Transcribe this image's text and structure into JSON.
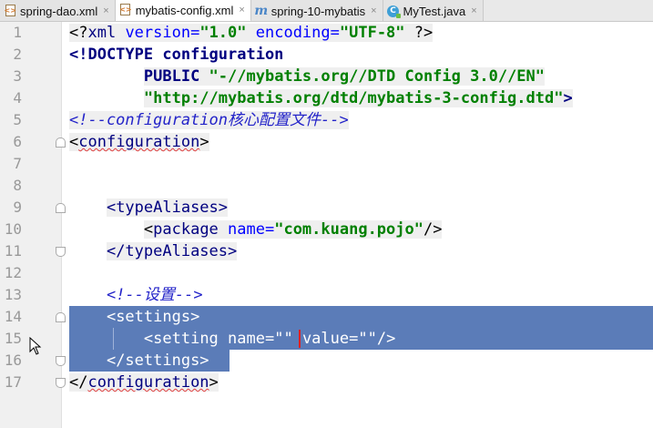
{
  "tabs": [
    {
      "label": "spring-dao.xml",
      "icon": "xml-file-icon",
      "close": "×",
      "active": false
    },
    {
      "label": "mybatis-config.xml",
      "icon": "xml-file-icon",
      "close": "×",
      "active": true
    },
    {
      "label": "spring-10-mybatis",
      "icon": "maven-module-icon",
      "close": "×",
      "active": false
    },
    {
      "label": "MyTest.java",
      "icon": "java-class-icon",
      "close": "×",
      "active": false
    }
  ],
  "line_numbers": [
    "1",
    "2",
    "3",
    "4",
    "5",
    "6",
    "7",
    "8",
    "9",
    "10",
    "11",
    "12",
    "13",
    "14",
    "15",
    "16",
    "17"
  ],
  "code": {
    "l1": {
      "open": "<?",
      "tag": "xml",
      "a1": " version=",
      "v1": "\"1.0\"",
      "a2": " encoding=",
      "v2": "\"UTF-8\"",
      "close": " ?>"
    },
    "l2": {
      "kw": "<!DOCTYPE",
      "name": " configuration"
    },
    "l3": {
      "indent": "        ",
      "kw": "PUBLIC",
      "str": " \"-//mybatis.org//DTD Config 3.0//EN\""
    },
    "l4": {
      "indent": "        ",
      "str": "\"http://mybatis.org/dtd/mybatis-3-config.dtd\"",
      "close": ">"
    },
    "l5": {
      "comment": "<!--configuration核心配置文件-->"
    },
    "l6": {
      "lt": "<",
      "tag": "configuration",
      "gt": ">"
    },
    "l9": {
      "indent": "    ",
      "text": "<typeAliases>"
    },
    "l10": {
      "indent": "        ",
      "lt": "<",
      "tag": "package",
      "attr": " name=",
      "val": "\"com.kuang.pojo\"",
      "gt": "/>"
    },
    "l11": {
      "indent": "    ",
      "text": "</typeAliases>"
    },
    "l13": {
      "indent": "    ",
      "comment": "<!--设置-->"
    },
    "l14": {
      "indent": "    ",
      "text": "<settings>"
    },
    "l15": {
      "indent": "        ",
      "lt": "<",
      "tag": "setting",
      "a1": " name=",
      "v1": "\"\"",
      "a2": " value=",
      "v2": "\"\"",
      "gt": "/>"
    },
    "l16": {
      "indent": "    ",
      "text": "</settings>"
    },
    "l17": {
      "lt": "</",
      "tag": "configuration",
      "gt": ">"
    }
  },
  "colors": {
    "selection": "#5b7cb8",
    "caret": "#e02020",
    "comment": "#2323c9",
    "string": "#008000",
    "tag": "#000080"
  }
}
